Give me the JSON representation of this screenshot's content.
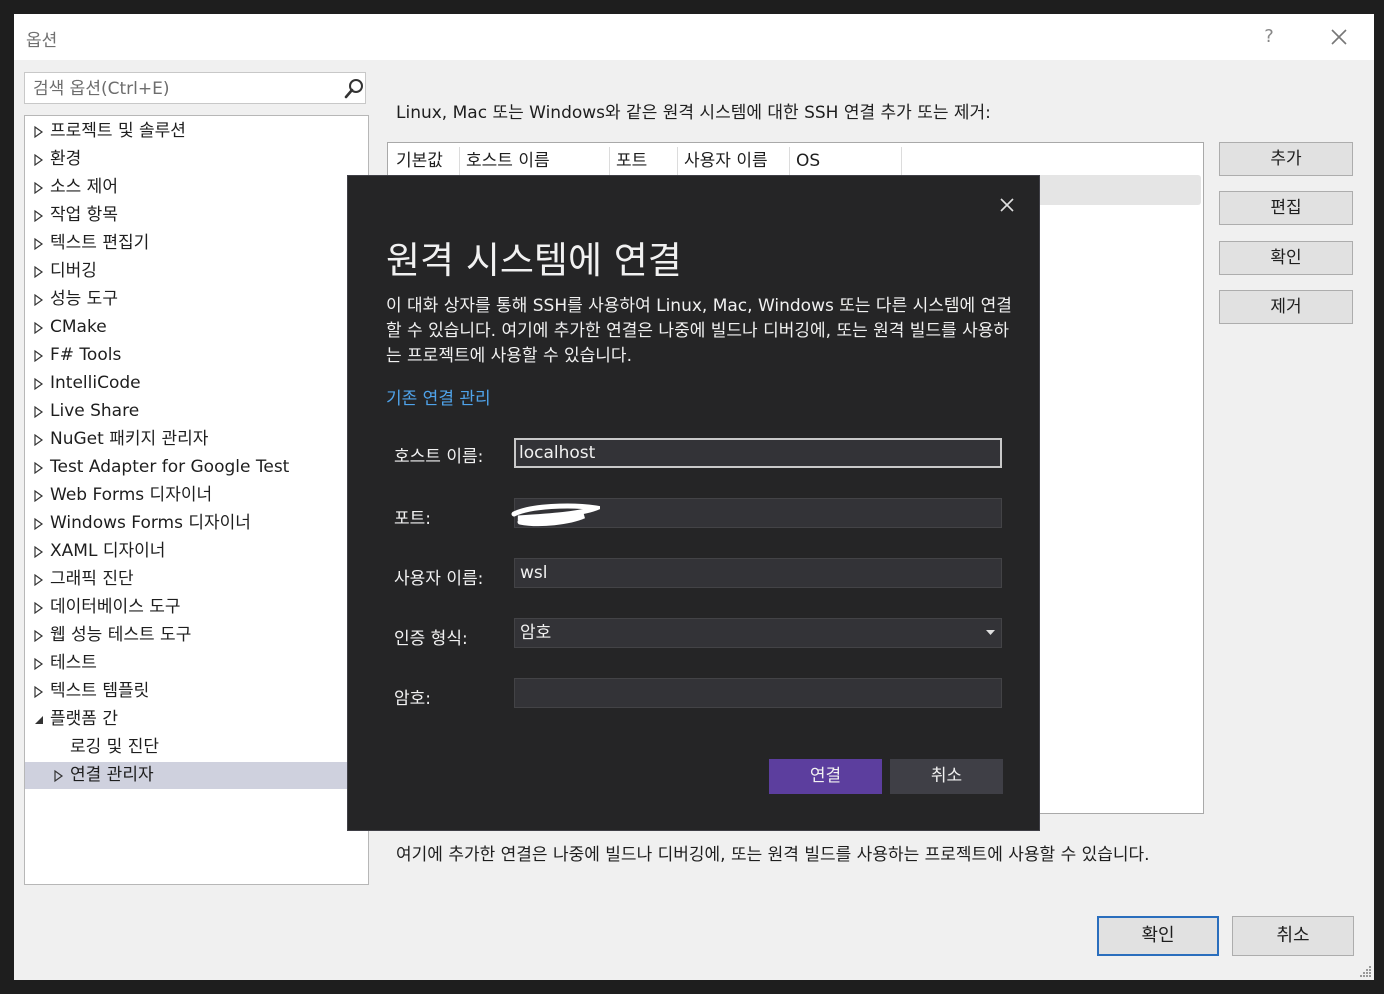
{
  "window": {
    "title": "옵션",
    "help": "?"
  },
  "search": {
    "placeholder": "검색 옵션(Ctrl+E)",
    "icon": "search-icon"
  },
  "tree": [
    {
      "label": "프로젝트 및 솔루션",
      "expanded": false
    },
    {
      "label": "환경",
      "expanded": false
    },
    {
      "label": "소스 제어",
      "expanded": false
    },
    {
      "label": "작업 항목",
      "expanded": false
    },
    {
      "label": "텍스트 편집기",
      "expanded": false
    },
    {
      "label": "디버깅",
      "expanded": false
    },
    {
      "label": "성능 도구",
      "expanded": false
    },
    {
      "label": "CMake",
      "expanded": false
    },
    {
      "label": "F# Tools",
      "expanded": false
    },
    {
      "label": "IntelliCode",
      "expanded": false
    },
    {
      "label": "Live Share",
      "expanded": false
    },
    {
      "label": "NuGet 패키지 관리자",
      "expanded": false
    },
    {
      "label": "Test Adapter for Google Test",
      "expanded": false
    },
    {
      "label": "Web Forms 디자이너",
      "expanded": false
    },
    {
      "label": "Windows Forms 디자이너",
      "expanded": false
    },
    {
      "label": "XAML 디자이너",
      "expanded": false
    },
    {
      "label": "그래픽 진단",
      "expanded": false
    },
    {
      "label": "데이터베이스 도구",
      "expanded": false
    },
    {
      "label": "웹 성능 테스트 도구",
      "expanded": false
    },
    {
      "label": "테스트",
      "expanded": false
    },
    {
      "label": "텍스트 템플릿",
      "expanded": false
    },
    {
      "label": "플랫폼 간",
      "expanded": true
    },
    {
      "label": "로깅 및 진단",
      "child": true
    },
    {
      "label": "연결 관리자",
      "child": true,
      "selected": true,
      "expanded": false
    }
  ],
  "main": {
    "description": "Linux, Mac 또는 Windows와 같은 원격 시스템에 대한 SSH 연결 추가 또는 제거:",
    "columns": [
      "기본값",
      "호스트 이름",
      "포트",
      "사용자 이름",
      "OS"
    ],
    "buttons": {
      "add": "추가",
      "edit": "편집",
      "verify": "확인",
      "remove": "제거"
    },
    "footer_note": "여기에 추가한 연결은 나중에 빌드나 디버깅에, 또는 원격 빌드를 사용하는 프로젝트에 사용할 수 있습니다."
  },
  "footer": {
    "ok": "확인",
    "cancel": "취소"
  },
  "modal": {
    "title": "원격 시스템에 연결",
    "description": "이 대화 상자를 통해 SSH를 사용하여 Linux, Mac, Windows 또는 다른 시스템에 연결할 수 있습니다. 여기에 추가한 연결은 나중에 빌드나 디버깅에, 또는 원격 빌드를 사용하는 프로젝트에 사용할 수 있습니다.",
    "manage_link": "기존 연결 관리",
    "host_label": "호스트 이름:",
    "host_value": "localhost",
    "port_label": "포트:",
    "port_value": "",
    "user_label": "사용자 이름:",
    "user_value": "wsl",
    "auth_label": "인증 형식:",
    "auth_value": "암호",
    "password_label": "암호:",
    "password_value": "",
    "connect": "연결",
    "cancel": "취소"
  },
  "colors": {
    "accent": "#5c3e9e",
    "link": "#4fa3ea",
    "selection": "#cfd1de"
  }
}
